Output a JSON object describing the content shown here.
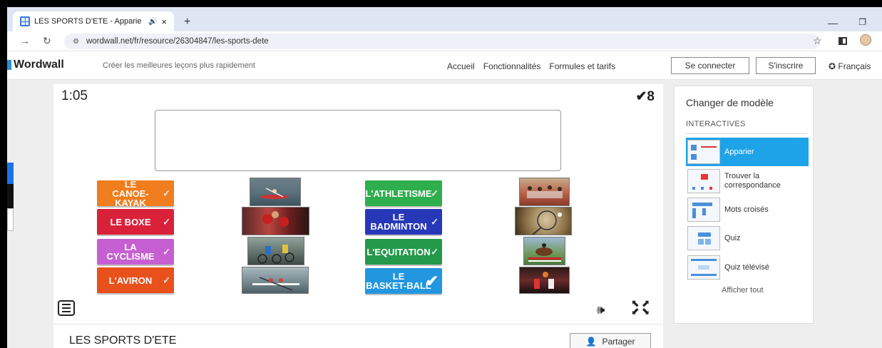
{
  "browser": {
    "tab_title": "LES SPORTS D'ETE - Apparie",
    "tab_audio_icon": "speaker-icon",
    "tab_close": "×",
    "new_tab": "+",
    "minimize": "—",
    "restore": "❐",
    "url": "wordwall.net/fr/resource/26304847/les-sports-dete"
  },
  "header": {
    "logo_text": "Wordwall",
    "tagline": "Créer les meilleures leçons plus rapidement",
    "nav": [
      "Accueil",
      "Fonctionnalités",
      "Formules et tarifs"
    ],
    "login_label": "Se connecter",
    "signup_label": "S'inscrire",
    "language": "Français"
  },
  "game": {
    "timer": "1:05",
    "score": "8",
    "title": "LES SPORTS D'ETE",
    "share_label": "Partager",
    "items": [
      {
        "label": "LE\nCANOE-KAYAK",
        "color": "#f07d1e"
      },
      {
        "label": "LE BOXE",
        "color": "#d9213a"
      },
      {
        "label": "LA\nCYCLISME",
        "color": "#c65fd1"
      },
      {
        "label": "L'AVIRON",
        "color": "#e8501c"
      },
      {
        "label": "L'ATHLETISME",
        "color": "#2fae4e"
      },
      {
        "label": "LE\nBADMINTON",
        "color": "#2638b8"
      },
      {
        "label": "L'EQUITATION",
        "color": "#24994a"
      },
      {
        "label": "LE\nBASKET-BALL",
        "color": "#2296de"
      }
    ]
  },
  "panel": {
    "title": "Changer de modèle",
    "subtitle": "INTERACTIVES",
    "templates": [
      {
        "label": "Apparier",
        "active": true
      },
      {
        "label": "Trouver la correspondance",
        "active": false
      },
      {
        "label": "Mots croisés",
        "active": false
      },
      {
        "label": "Quiz",
        "active": false
      },
      {
        "label": "Quiz télévisé",
        "active": false
      }
    ],
    "show_all": "Afficher tout"
  },
  "colors": {
    "tab_strip": "#dfe6f3",
    "active_template": "#1ea3e8",
    "page_bg": "#eeeeee"
  }
}
